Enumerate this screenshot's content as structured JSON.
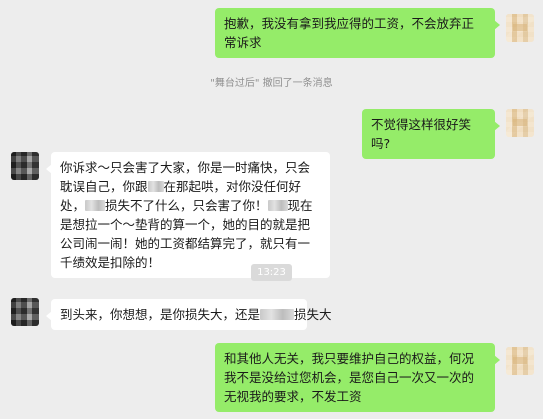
{
  "messages": [
    {
      "from": "self",
      "text": "抱歉，我没有拿到我应得的工资，不会放弃正常诉求"
    },
    {
      "from": "system_recall",
      "text": "\"舞台过后\" 撤回了一条消息"
    },
    {
      "from": "self",
      "text": "不觉得这样很好笑吗?"
    },
    {
      "from": "other",
      "parts": {
        "p1": "你诉求～只会害了大家，你是一时痛快，只会耽误自己，你跟",
        "p2": "在那起哄，对你没任何好处，",
        "p3": "损失不了什么，只会害了你！",
        "p4": "现在是想拉一个～垫背的算一个，她的目的就是把公司闹一闹！她的工资都结算完了，就只有一千绩效是扣除的！"
      }
    },
    {
      "from": "system_time",
      "text": "13:23"
    },
    {
      "from": "other",
      "parts": {
        "p1": "到头来，你想想，是你损失大，还是",
        "p2": "损失大"
      }
    },
    {
      "from": "self",
      "text": "和其他人无关，我只要维护自己的权益，何况我不是没给过您机会，是您自己一次又一次的无视我的要求，不发工资"
    }
  ],
  "colors": {
    "background": "#ededed",
    "self_bubble": "#95ec69",
    "other_bubble": "#ffffff"
  }
}
